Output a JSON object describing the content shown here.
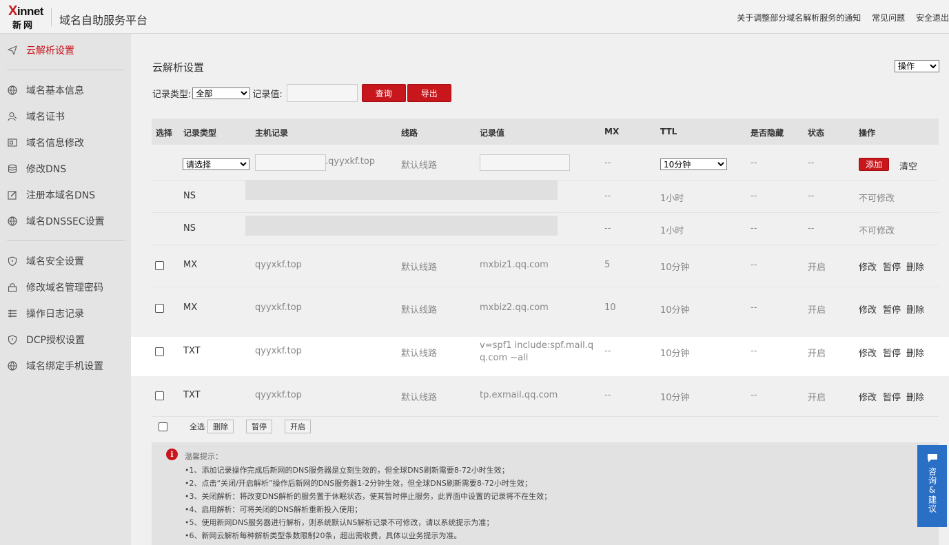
{
  "header": {
    "logo_brand": "Xinnet",
    "logo_cn": "新网",
    "title": "域名自助服务平台",
    "links": [
      "关于调整部分域名解析服务的通知",
      "常见问题",
      "安全退出"
    ]
  },
  "sidebar": {
    "items": [
      {
        "label": "云解析设置",
        "icon": "send-icon"
      },
      {
        "label": "域名基本信息",
        "icon": "globe-icon"
      },
      {
        "label": "域名证书",
        "icon": "user-certificate-icon"
      },
      {
        "label": "域名信息修改",
        "icon": "id-card-icon"
      },
      {
        "label": "修改DNS",
        "icon": "database-icon"
      },
      {
        "label": "注册本域名DNS",
        "icon": "edit-icon"
      },
      {
        "label": "域名DNSSEC设置",
        "icon": "globe-icon"
      },
      {
        "label": "域名安全设置",
        "icon": "shield-icon"
      },
      {
        "label": "修改域名管理密码",
        "icon": "lock-icon"
      },
      {
        "label": "操作日志记录",
        "icon": "list-icon"
      },
      {
        "label": "DCP授权设置",
        "icon": "shield-icon"
      },
      {
        "label": "域名绑定手机设置",
        "icon": "globe-icon"
      }
    ]
  },
  "main": {
    "page_title": "云解析设置",
    "ops_select": "操作",
    "filter": {
      "type_label": "记录类型:",
      "type_value": "全部",
      "value_label": "记录值:",
      "value_input": "",
      "query_button": "查询",
      "export_button": "导出"
    },
    "columns": [
      "选择",
      "记录类型",
      "主机记录",
      "线路",
      "记录值",
      "MX",
      "TTL",
      "是否隐藏",
      "状态",
      "操作"
    ],
    "add_row": {
      "type_select": "请选择",
      "host_input": "",
      "host_suffix": ".qyyxkf.top",
      "line": "默认线路",
      "value_input": "",
      "mx": "--",
      "ttl_select": "10分钟",
      "hidden": "--",
      "status": "--",
      "add_button": "添加",
      "clear_button": "清空"
    },
    "ns_rows": [
      {
        "type": "NS",
        "mx": "--",
        "ttl": "1小时",
        "hidden": "--",
        "status": "--",
        "op": "不可修改"
      },
      {
        "type": "NS",
        "mx": "--",
        "ttl": "1小时",
        "hidden": "--",
        "status": "--",
        "op": "不可修改"
      }
    ],
    "records": [
      {
        "type": "MX",
        "host": "qyyxkf.top",
        "line": "默认线路",
        "value": "mxbiz1.qq.com",
        "mx": "5",
        "ttl": "10分钟",
        "hidden": "--",
        "status": "开启",
        "edit": "修改",
        "pause": "暂停",
        "delete": "删除"
      },
      {
        "type": "MX",
        "host": "qyyxkf.top",
        "line": "默认线路",
        "value": "mxbiz2.qq.com",
        "mx": "10",
        "ttl": "10分钟",
        "hidden": "--",
        "status": "开启",
        "edit": "修改",
        "pause": "暂停",
        "delete": "删除"
      },
      {
        "type": "TXT",
        "host": "qyyxkf.top",
        "line": "默认线路",
        "value": "v=spf1 include:spf.mail.qq.com ~all",
        "mx": "--",
        "ttl": "10分钟",
        "hidden": "--",
        "status": "开启",
        "edit": "修改",
        "pause": "暂停",
        "delete": "删除"
      },
      {
        "type": "TXT",
        "host": "qyyxkf.top",
        "line": "默认线路",
        "value": "tp.exmail.qq.com",
        "mx": "--",
        "ttl": "10分钟",
        "hidden": "--",
        "status": "开启",
        "edit": "修改",
        "pause": "暂停",
        "delete": "删除"
      }
    ],
    "bulk": {
      "select_all": "全选",
      "delete": "删除",
      "pause": "暂停",
      "enable": "开启"
    },
    "tips": {
      "title": "温馨提示：",
      "lines": [
        "•1、添加记录操作完成后新网的DNS服务器是立刻生效的，但全球DNS刷新需要8-72小时生效；",
        "•2、点击“关闭/开启解析”操作后新网的DNS服务器1-2分钟生效，但全球DNS刷新需要8-72小时生效；",
        "•3、关闭解析：将改变DNS解析的服务置于休眠状态，使其暂时停止服务，此界面中设置的记录将不在生效；",
        "•4、启用解析：可将关闭的DNS解析重新投入使用；",
        "•5、使用新网DNS服务器进行解析，则系统默认NS解析记录不可修改，请以系统提示为准；",
        "•6、新网云解析每种解析类型条数限制20条，超出需收费，具体以业务提示为准。"
      ]
    }
  },
  "feedback": {
    "label": "咨询&建议"
  },
  "colors": {
    "accent": "#c8161d",
    "feedback_blue": "#2a6fc6"
  }
}
